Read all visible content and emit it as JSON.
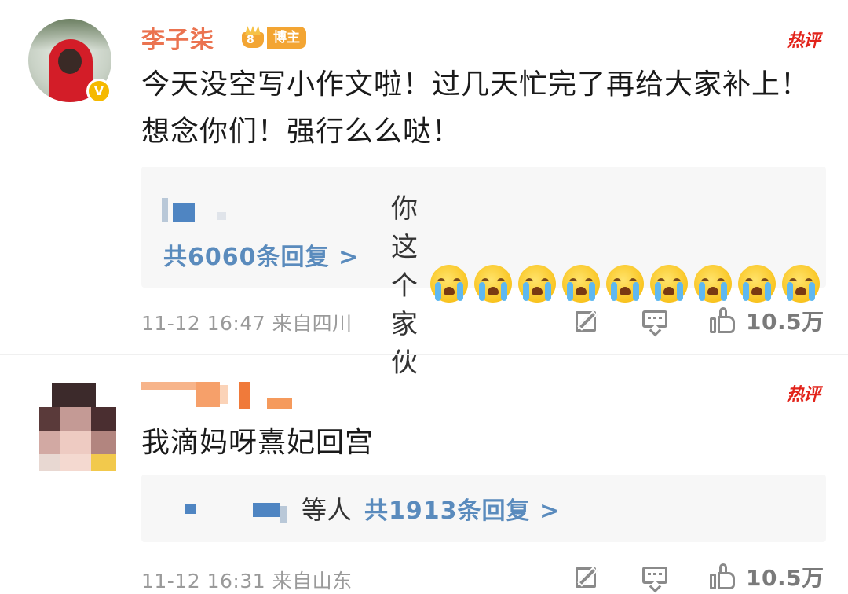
{
  "comments": [
    {
      "username": "李子柒",
      "badge_level": "8",
      "badge_label": "博主",
      "hot_label": "热评",
      "text": "今天没空写小作文啦！过几天忙完了再给大家补上！想念你们！强行么么哒！",
      "reply": {
        "text": "你这个家伙",
        "emoji": "crying-face-icon",
        "emoji_count": 9,
        "count_label": "共6060条回复 >"
      },
      "time": "11-12 16:47",
      "location": "来自四川",
      "likes": "10.5万"
    },
    {
      "username": "",
      "hot_label": "热评",
      "text": "我滴妈呀熹妃回宫",
      "reply": {
        "suffix": "等人",
        "count_label": "共1913条回复 >"
      },
      "time": "11-12 16:31",
      "location": "来自山东",
      "likes": "10.5万"
    }
  ],
  "icons": {
    "edit": "edit-icon",
    "comment": "comment-icon",
    "like": "thumbs-up-icon",
    "verified": "verified-v-icon"
  },
  "colors": {
    "username": "#eb7350",
    "hot_label": "#e2231a",
    "reply_link": "#5a8bbd",
    "badge": "#f3a533",
    "verified": "#f5b900"
  }
}
